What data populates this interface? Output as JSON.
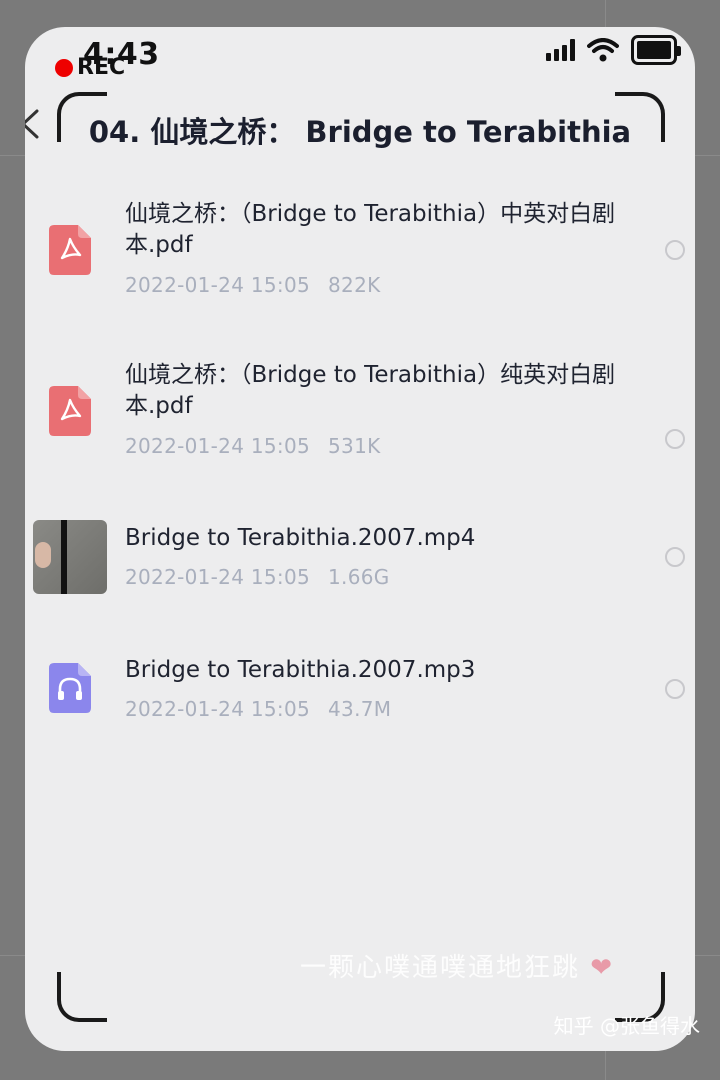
{
  "status_bar": {
    "time": "4:43",
    "rec_label": "REC"
  },
  "header": {
    "title": "04. 仙境之桥： Bridge to Terabithia"
  },
  "files": [
    {
      "name": "仙境之桥：（Bridge to Terabithia）中英对白剧本.pdf",
      "date": "2022-01-24 15:05",
      "size": "822K",
      "icon": "pdf-icon"
    },
    {
      "name": "仙境之桥：（Bridge to Terabithia）纯英对白剧本.pdf",
      "date": "2022-01-24 15:05",
      "size": "531K",
      "icon": "pdf-icon"
    },
    {
      "name": "Bridge to Terabithia.2007.mp4",
      "date": "2022-01-24 15:05",
      "size": "1.66G",
      "icon": "video-thumbnail"
    },
    {
      "name": "Bridge to Terabithia.2007.mp3",
      "date": "2022-01-24 15:05",
      "size": "43.7M",
      "icon": "audio-icon"
    }
  ],
  "overlay": {
    "watermark": "一颗心噗通噗通地狂跳",
    "credit": "知乎 @张鱼得水"
  },
  "colors": {
    "pdf": "#e96f73",
    "audio": "#8b86ec",
    "title_text": "#1b1f2e",
    "meta_text": "#a9afbd"
  }
}
